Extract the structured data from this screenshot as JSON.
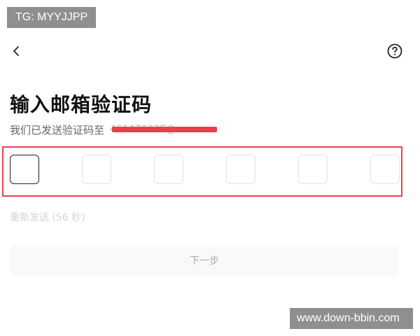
{
  "watermark_top": "TG: MYYJJPP",
  "watermark_bottom": "www.down-bbin.com",
  "header": {
    "back_icon": "chevron-left-icon",
    "help_icon": "question-circle-icon"
  },
  "title": "输入邮箱验证码",
  "subtitle": "我们已发送验证码至",
  "masked_email": "46147003E@ ·",
  "code_inputs": [
    "",
    "",
    "",
    "",
    "",
    ""
  ],
  "resend_label": "重新发送 (56 秒)",
  "next_button_label": "下一步",
  "colors": {
    "highlight_frame": "#e34550",
    "redaction": "#e8414c",
    "text_primary": "#111111",
    "text_secondary": "#666666",
    "disabled_text": "#a9a9a9"
  }
}
